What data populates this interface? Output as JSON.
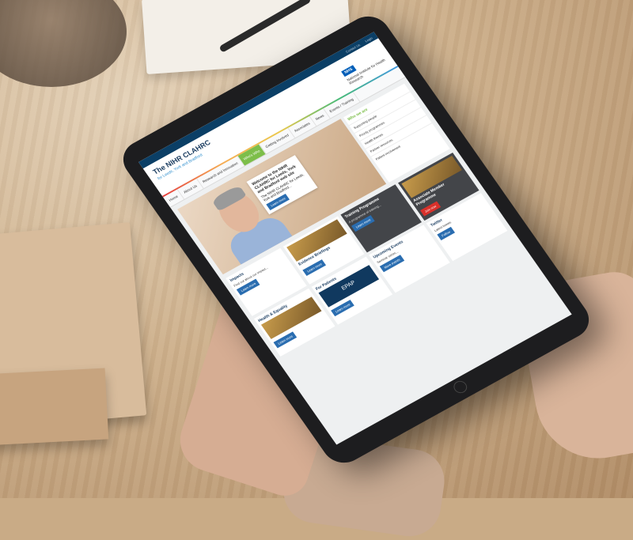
{
  "site": {
    "title": "The NIHR CLAHRC",
    "subtitle": "for Leeds, York and Bradford",
    "nhs_badge": "NHS",
    "nihr_name": "National Institute for Health Research",
    "topbar_links": [
      "Contact Us",
      "Login"
    ]
  },
  "nav": {
    "items": [
      "Home",
      "About Us",
      "Research and Innovation",
      "Partner Resources",
      "Getting Involved",
      "Associates",
      "News",
      "Events / Training"
    ],
    "active_index": 3,
    "active_label": "Who's Who"
  },
  "hero": {
    "welcome_title": "Welcome to the NIHR CLAHRC for Leeds, York and Bradford web site",
    "welcome_text": "The NIHR CLAHRC for Leeds, York and Bradford...",
    "learn_more": "Learn more"
  },
  "sidebar": {
    "heading": "Who we are",
    "items": [
      "Supporting people",
      "Priority programmes",
      "Health themes",
      "Partner resources",
      "Patient involvement"
    ]
  },
  "cards": [
    {
      "title": "Impacts",
      "text": "Find out about our impact...",
      "button": "Learn more"
    },
    {
      "title": "Evidence Briefings",
      "text": "Our evidence briefings...",
      "button": "Learn more"
    },
    {
      "title": "Training Programme",
      "text": "A programme of training...",
      "button": "Learn more"
    },
    {
      "title": "Associate Member Programme",
      "text": "Join our associates...",
      "button": "Join now"
    },
    {
      "title": "Health & Equality",
      "text": "Our work on health equality...",
      "button": "Learn more"
    },
    {
      "title": "For Patients",
      "text": "EPAP",
      "button": "Learn more"
    },
    {
      "title": "Upcoming Events",
      "text": "Seminar series...",
      "button": "More events"
    },
    {
      "title": "Twitter",
      "text": "Latest tweets",
      "button": "Follow"
    }
  ],
  "colors": {
    "nav_active": "#7dbe4a",
    "header_bar": "#0b3f66",
    "button": "#2a6db0",
    "accent_red": "#d9312b"
  }
}
